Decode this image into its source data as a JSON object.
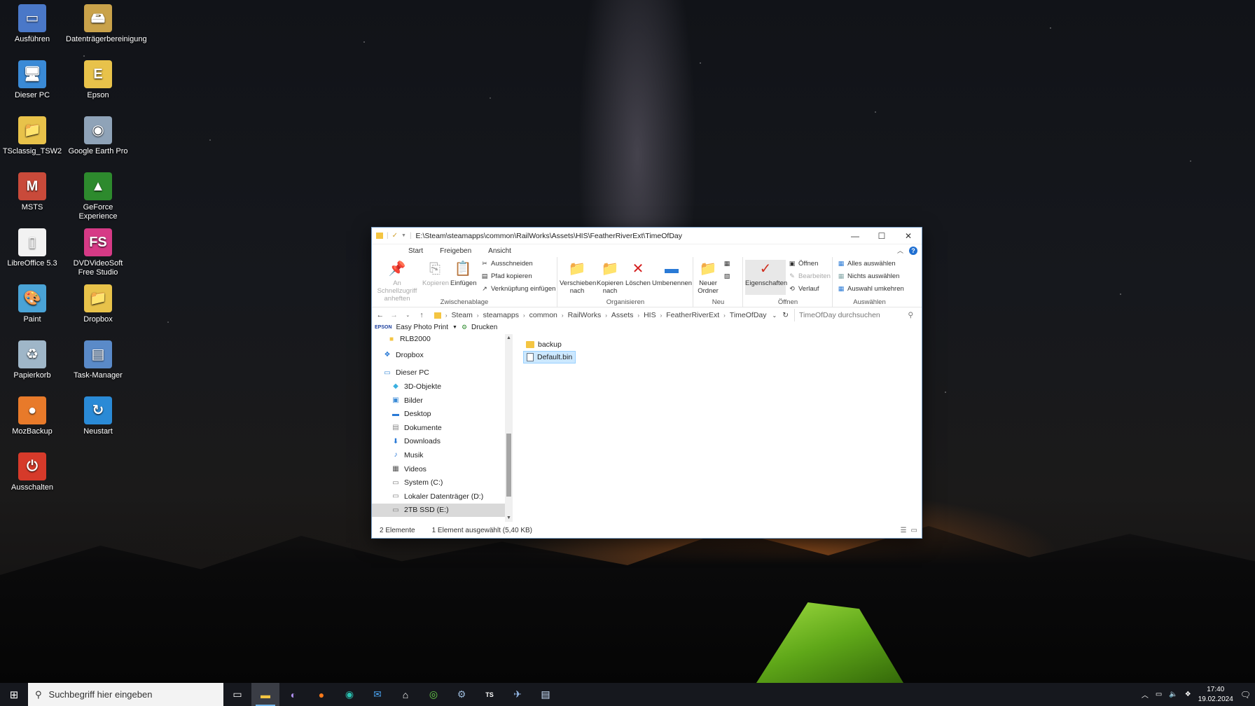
{
  "desktop_icons": [
    {
      "label": "Ausführen",
      "icon": "run-icon",
      "color": "#4a78c8",
      "glyph": "▭"
    },
    {
      "label": "Datenträgerbereinigung",
      "icon": "disk-cleanup-icon",
      "color": "#c9a24a",
      "glyph": "🖴"
    },
    {
      "label": "Dieser PC",
      "icon": "computer-icon",
      "color": "#3a8ad6",
      "glyph": "🖥"
    },
    {
      "label": "Epson",
      "icon": "epson-folder-icon",
      "color": "#e8c24a",
      "glyph": "E"
    },
    {
      "label": "TSclassig_TSW2",
      "icon": "folder-icon",
      "color": "#e8c24a",
      "glyph": "📁"
    },
    {
      "label": "Google Earth Pro",
      "icon": "google-earth-icon",
      "color": "#8fa3b8",
      "glyph": "◉"
    },
    {
      "label": "MSTS",
      "icon": "msts-folder-icon",
      "color": "#c94a3a",
      "glyph": "M"
    },
    {
      "label": "GeForce Experience",
      "icon": "geforce-icon",
      "color": "#2d8a2d",
      "glyph": "▲"
    },
    {
      "label": "LibreOffice 5.3",
      "icon": "document-icon",
      "color": "#f2f2f2",
      "glyph": "▯"
    },
    {
      "label": "DVDVideoSoft Free Studio",
      "icon": "freestudio-icon",
      "color": "#d63a86",
      "glyph": "FS"
    },
    {
      "label": "Paint",
      "icon": "paint-icon",
      "color": "#4aa3d6",
      "glyph": "🎨"
    },
    {
      "label": "Dropbox",
      "icon": "dropbox-folder-icon",
      "color": "#e8c24a",
      "glyph": "📁"
    },
    {
      "label": "Papierkorb",
      "icon": "recycle-bin-icon",
      "color": "#9fb6c8",
      "glyph": "♻"
    },
    {
      "label": "Task-Manager",
      "icon": "task-manager-icon",
      "color": "#5a8ac8",
      "glyph": "▤"
    },
    {
      "label": "MozBackup",
      "icon": "mozbackup-icon",
      "color": "#e87a2a",
      "glyph": "●"
    },
    {
      "label": "Neustart",
      "icon": "restart-icon",
      "color": "#2a8ad6",
      "glyph": "↻"
    },
    {
      "label": "Ausschalten",
      "icon": "power-icon",
      "color": "#d63a2a",
      "glyph": "⏻"
    }
  ],
  "explorer": {
    "title_path": "E:\\Steam\\steamapps\\common\\RailWorks\\Assets\\HIS\\FeatherRiverExt\\TimeOfDay",
    "tabs": [
      "Start",
      "Freigeben",
      "Ansicht"
    ],
    "ribbon": {
      "pin_label": "An Schnellzugriff anheften",
      "copy_label": "Kopieren",
      "paste_label": "Einfügen",
      "cut_label": "Ausschneiden",
      "copy_path_label": "Pfad kopieren",
      "paste_shortcut_label": "Verknüpfung einfügen",
      "group_clipboard": "Zwischenablage",
      "move_to_label": "Verschieben nach",
      "copy_to_label": "Kopieren nach",
      "delete_label": "Löschen",
      "rename_label": "Umbenennen",
      "group_organize": "Organisieren",
      "new_folder_label": "Neuer Ordner",
      "group_new": "Neu",
      "properties_label": "Eigenschaften",
      "open_label": "Öffnen",
      "edit_label": "Bearbeiten",
      "history_label": "Verlauf",
      "group_open": "Öffnen",
      "select_all_label": "Alles auswählen",
      "select_none_label": "Nichts auswählen",
      "invert_selection_label": "Auswahl umkehren",
      "group_select": "Auswählen"
    },
    "breadcrumbs": [
      "Steam",
      "steamapps",
      "common",
      "RailWorks",
      "Assets",
      "HIS",
      "FeatherRiverExt",
      "TimeOfDay"
    ],
    "search_placeholder": "TimeOfDay durchsuchen",
    "favbar": {
      "brand": "EPSON",
      "app": "Easy Photo Print",
      "print": "Drucken"
    },
    "nav_items": [
      {
        "label": "RLB2000",
        "icon": "folder-icon",
        "indent": 22
      },
      {
        "label": "",
        "icon": "",
        "indent": 0
      },
      {
        "label": "Dropbox",
        "icon": "dropbox-icon",
        "indent": 16
      },
      {
        "label": "",
        "icon": "",
        "indent": 0
      },
      {
        "label": "Dieser PC",
        "icon": "computer-icon",
        "indent": 16
      },
      {
        "label": "3D-Objekte",
        "icon": "3d-objects-icon",
        "indent": 28
      },
      {
        "label": "Bilder",
        "icon": "pictures-icon",
        "indent": 28
      },
      {
        "label": "Desktop",
        "icon": "desktop-icon",
        "indent": 28
      },
      {
        "label": "Dokumente",
        "icon": "documents-icon",
        "indent": 28
      },
      {
        "label": "Downloads",
        "icon": "downloads-icon",
        "indent": 28
      },
      {
        "label": "Musik",
        "icon": "music-icon",
        "indent": 28
      },
      {
        "label": "Videos",
        "icon": "videos-icon",
        "indent": 28
      },
      {
        "label": "System (C:)",
        "icon": "drive-icon",
        "indent": 28
      },
      {
        "label": "Lokaler Datenträger (D:)",
        "icon": "drive-icon",
        "indent": 28
      },
      {
        "label": "2TB SSD (E:)",
        "icon": "drive-icon",
        "indent": 28,
        "selected": true
      }
    ],
    "files": [
      {
        "name": "backup",
        "type": "folder"
      },
      {
        "name": "Default.bin",
        "type": "bin",
        "selected": true
      }
    ],
    "status": {
      "count": "2 Elemente",
      "selection": "1 Element ausgewählt (5,40 KB)"
    }
  },
  "taskbar": {
    "search_placeholder": "Suchbegriff hier eingeben",
    "time": "17:40",
    "date": "19.02.2024",
    "accent": "#76b9ed"
  }
}
